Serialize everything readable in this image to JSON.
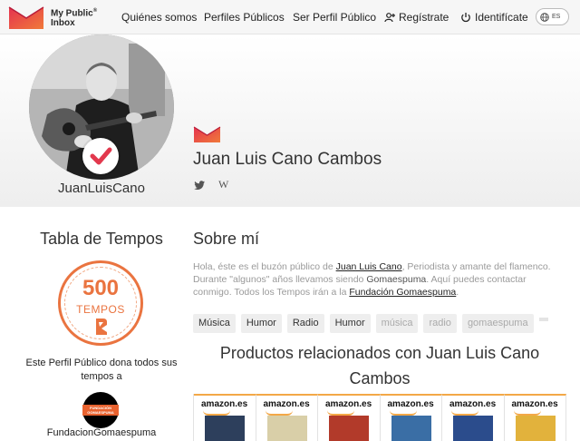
{
  "nav": {
    "logo_text_line1": "My Public",
    "logo_text_line2": "Inbox",
    "items": [
      {
        "label": "Quiénes somos"
      },
      {
        "label": "Perfiles Públicos"
      },
      {
        "label": "Ser Perfil Público"
      },
      {
        "label": "Regístrate",
        "icon": "add-user-icon"
      },
      {
        "label": "Identifícate",
        "icon": "power-icon"
      }
    ],
    "language": "ES"
  },
  "profile": {
    "username": "JuanLuisCano",
    "full_name": "Juan Luis Cano Cambos",
    "social": [
      "twitter-icon",
      "W"
    ]
  },
  "left": {
    "tabla_title": "Tabla de Tempos",
    "tempos_number": "500",
    "tempos_label": "TEMPOS",
    "dona_text": "Este Perfil Público dona todos sus tempos a",
    "foundation_logo_text": "FUNDACIÓN GOMAESPUMA",
    "foundation_name": "FundacionGomaespuma"
  },
  "about": {
    "title": "Sobre mí",
    "p1": "Hola, éste es el buzón público de ",
    "link_name": "Juan Luis Cano",
    "p2": ", Periodista y amante del flamenco. Durante \"algunos\" años llevamos siendo ",
    "strong": "Gomaespuma",
    "p3": ". Aquí puedes contactar conmigo. Todos los Tempos irán a la ",
    "link_foundation": "Fundación Gomaespuma",
    "p4": "."
  },
  "tags": [
    "Música",
    "Humor",
    "Radio",
    "Humor",
    "música",
    "radio",
    "gomaespuma"
  ],
  "productos": {
    "title": "Productos relacionados con Juan Luis Cano Cambos",
    "store_label": "amazon.es",
    "book_colors": [
      "#2d3f5c",
      "#d9cfa8",
      "#b23a2a",
      "#3a6ea5",
      "#2b4c8c",
      "#e2b23c"
    ]
  },
  "colors": {
    "brand_red": "#e2384d",
    "accent_orange": "#ea7440"
  }
}
